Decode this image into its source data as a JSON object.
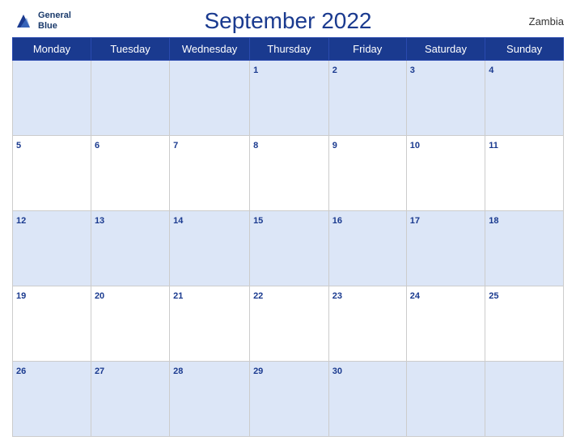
{
  "header": {
    "title": "September 2022",
    "country": "Zambia",
    "logo": {
      "line1": "General",
      "line2": "Blue"
    }
  },
  "days_of_week": [
    "Monday",
    "Tuesday",
    "Wednesday",
    "Thursday",
    "Friday",
    "Saturday",
    "Sunday"
  ],
  "weeks": [
    [
      null,
      null,
      null,
      1,
      2,
      3,
      4
    ],
    [
      5,
      6,
      7,
      8,
      9,
      10,
      11
    ],
    [
      12,
      13,
      14,
      15,
      16,
      17,
      18
    ],
    [
      19,
      20,
      21,
      22,
      23,
      24,
      25
    ],
    [
      26,
      27,
      28,
      29,
      30,
      null,
      null
    ]
  ],
  "colors": {
    "header_bg": "#1a3a8f",
    "odd_row_bg": "#dce6f7",
    "even_row_bg": "#ffffff",
    "text_blue": "#1a3a8f"
  }
}
